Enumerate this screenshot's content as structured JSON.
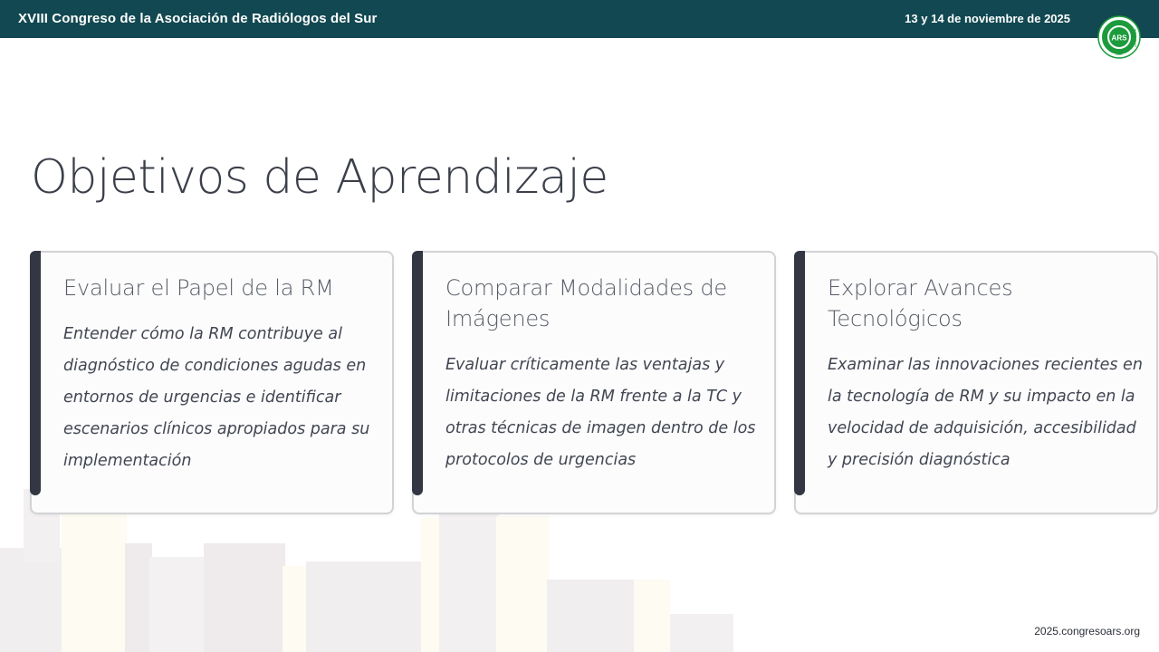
{
  "header": {
    "title": "XVIII Congreso de la Asociación de Radiólogos del Sur",
    "date": "13 y 14 de noviembre de 2025"
  },
  "logo": {
    "abbr": "ARS",
    "ring_top": "ASOCIACION",
    "ring_right": "RADIOLOGOS",
    "ring_bottom": "SUR",
    "color": "#1c9b3c"
  },
  "page": {
    "title": "Objetivos de Aprendizaje"
  },
  "cards": [
    {
      "title": "Evaluar el Papel de la RM",
      "description": "Entender cómo la RM contribuye al diagnóstico de condiciones agudas en entornos de urgencias e identificar escenarios clínicos apropiados para su implementación"
    },
    {
      "title": "Comparar Modalidades de Imágenes",
      "description": "Evaluar críticamente las ventajas y limitaciones de la RM frente a la TC y otras técnicas de imagen dentro de los protocolos de urgencias"
    },
    {
      "title": "Explorar Avances Tecnológicos",
      "description": "Examinar las innovaciones recientes en la tecnología de RM y su impacto en la velocidad de adquisición, accesibilidad y precisión diagnóstica"
    }
  ],
  "footer": {
    "url": "2025.congresoars.org"
  },
  "colors": {
    "header_bg": "#114851",
    "card_accent": "#323743",
    "title_text": "#3b3f4a"
  }
}
